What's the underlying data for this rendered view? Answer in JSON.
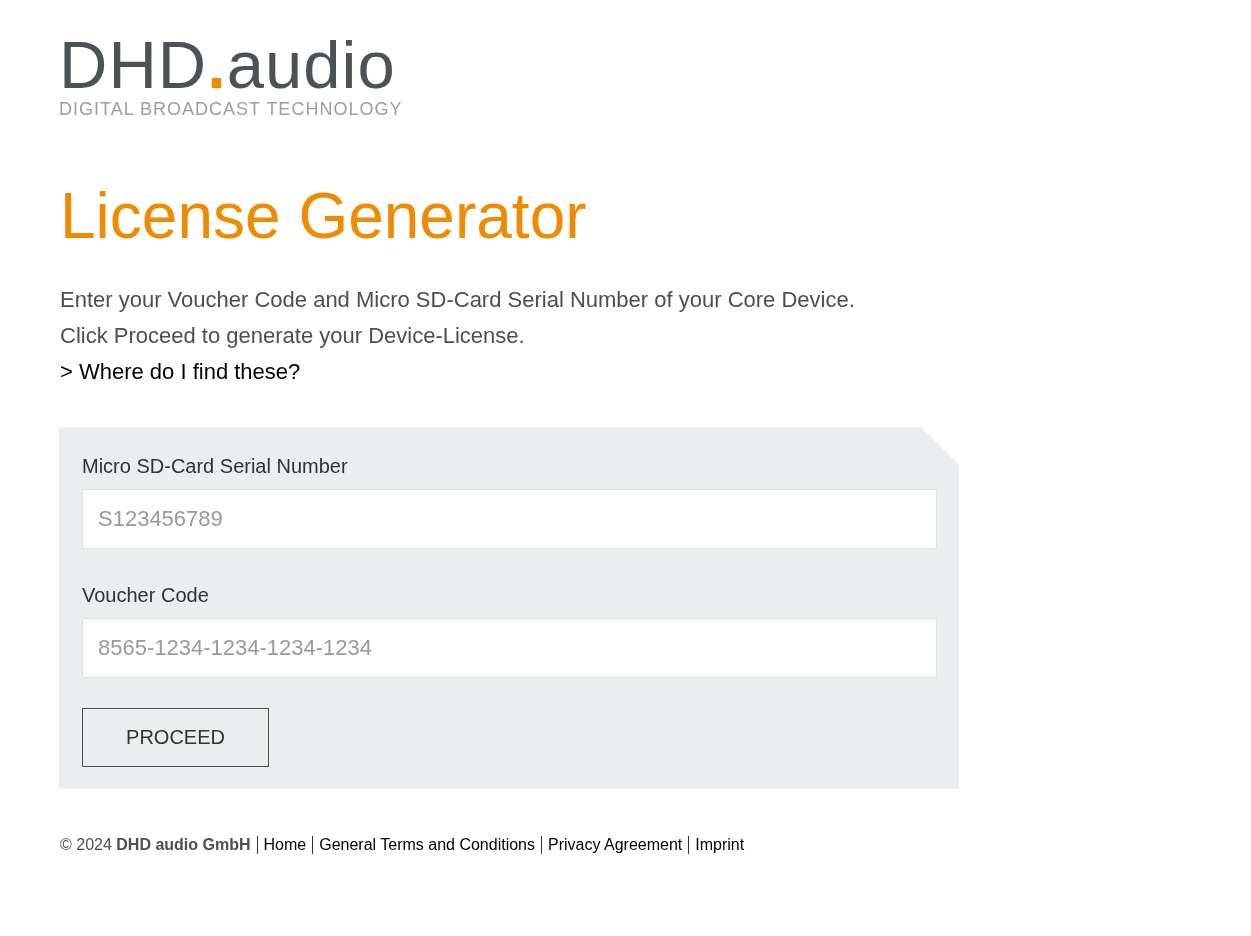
{
  "logo": {
    "brand": "DHD",
    "dot": ".",
    "suffix": "audio",
    "tagline": "DIGITAL BROADCAST TECHNOLOGY"
  },
  "title": "License Generator",
  "intro": [
    "Enter your Voucher Code and Micro SD-Card Serial Number of your Core Device.",
    "Click Proceed to generate your Device-License."
  ],
  "help_link": "> Where do I find these?",
  "form": {
    "fields": [
      {
        "label": "Micro SD-Card Serial Number",
        "placeholder": "S123456789"
      },
      {
        "label": "Voucher Code",
        "placeholder": "8565-1234-1234-1234-1234"
      }
    ],
    "button": "PROCEED"
  },
  "footer": {
    "copyright": "© 2024 **DHD audio GmbH**",
    "links": [
      "Home",
      "General Terms and Conditions",
      "Privacy Agreement",
      "Imprint"
    ]
  }
}
